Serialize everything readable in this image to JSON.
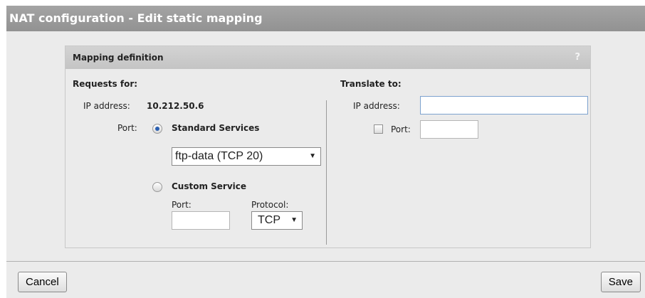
{
  "window": {
    "title": "NAT configuration - Edit static mapping"
  },
  "panel": {
    "title": "Mapping definition",
    "help_icon": "?"
  },
  "requests_for": {
    "heading": "Requests for:",
    "ip_label": "IP address:",
    "ip_value": "10.212.50.6",
    "port_label": "Port:",
    "standard_services": {
      "label": "Standard Services",
      "selected": true,
      "select_value": "ftp-data (TCP 20)"
    },
    "custom_service": {
      "label": "Custom Service",
      "selected": false,
      "port_label": "Port:",
      "port_value": "",
      "protocol_label": "Protocol:",
      "protocol_value": "TCP"
    }
  },
  "translate_to": {
    "heading": "Translate to:",
    "ip_label": "IP address:",
    "ip_value": "",
    "port_label": "Port:",
    "port_checked": false,
    "port_value": ""
  },
  "footer": {
    "cancel_label": "Cancel",
    "save_label": "Save"
  },
  "icons": {
    "help": "question-mark-icon",
    "dropdown": "chevron-down-icon"
  },
  "colors": {
    "title_bar": "#9b9b9b",
    "panel_header": "#cbcbcb",
    "content_bg": "#ebebeb",
    "radio_selected": "#2a5fb0"
  }
}
